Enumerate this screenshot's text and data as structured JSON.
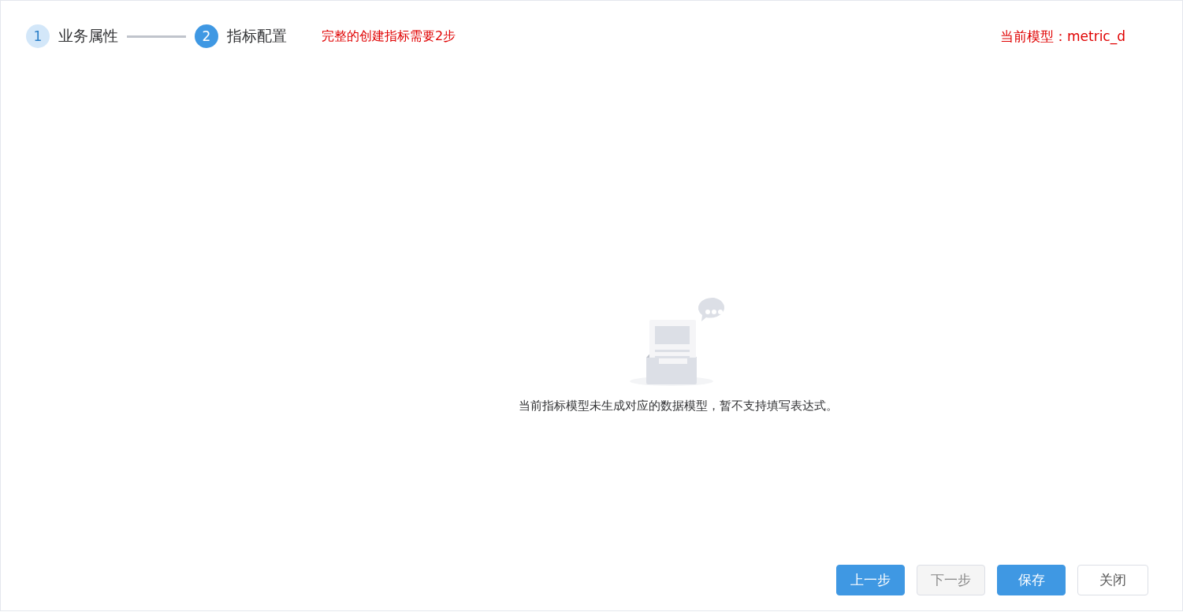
{
  "steps": [
    {
      "number": "1",
      "label": "业务属性",
      "selected": false
    },
    {
      "number": "2",
      "label": "指标配置",
      "selected": true
    }
  ],
  "hint": "完整的创建指标需要2步",
  "current_model": "当前模型：metric_d",
  "empty_state": {
    "message": "当前指标模型未生成对应的数据模型，暂不支持填写表达式。"
  },
  "buttons": [
    {
      "label": "上一步",
      "kind": "primary"
    },
    {
      "label": "下一步",
      "kind": "disabled"
    },
    {
      "label": "保存",
      "kind": "primary"
    },
    {
      "label": "关闭",
      "kind": "default"
    }
  ]
}
